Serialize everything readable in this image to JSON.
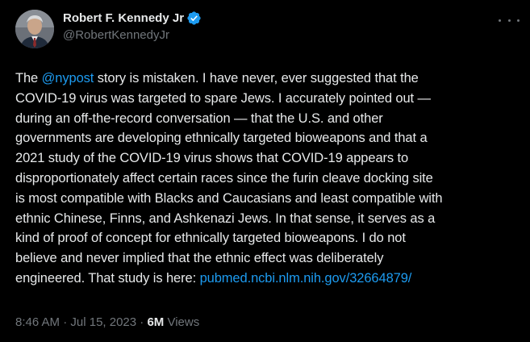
{
  "author": {
    "display_name": "Robert F. Kennedy Jr",
    "handle": "@RobertKennedyJr",
    "verified": true,
    "avatar_icon": "profile-photo"
  },
  "menu": {
    "more_icon": "more-horizontal-icon"
  },
  "tweet": {
    "lines": [
      {
        "before": "The ",
        "mention": "@nypost",
        "after": " story is mistaken. I have never, ever suggested that the"
      },
      {
        "text": "COVID-19 virus was targeted to spare Jews. I accurately pointed out —"
      },
      {
        "text": "during an off-the-record conversation — that the U.S. and other"
      },
      {
        "text": "governments are developing ethnically targeted bioweapons and that a"
      },
      {
        "text": "2021 study of the COVID-19 virus shows that COVID-19 appears to"
      },
      {
        "text": "disproportionately affect certain races since the furin cleave docking site"
      },
      {
        "text": "is most compatible with Blacks and Caucasians and least compatible with"
      },
      {
        "text": "ethnic Chinese, Finns, and Ashkenazi Jews. In that sense, it serves as a"
      },
      {
        "text": "kind of proof of concept for ethnically targeted bioweapons. I do not"
      },
      {
        "text": "believe and never implied that the ethnic effect was deliberately"
      },
      {
        "before": "engineered. That study is here: ",
        "link": "pubmed.ncbi.nlm.nih.gov/32664879/"
      }
    ]
  },
  "meta": {
    "time": "8:46 AM",
    "separator": "·",
    "date": "Jul 15, 2023",
    "views_count": "6M",
    "views_label": "Views"
  },
  "colors": {
    "background": "#000000",
    "text": "#e7e9ea",
    "secondary": "#71767b",
    "link": "#1d9bf0",
    "verified": "#1d9bf0"
  }
}
